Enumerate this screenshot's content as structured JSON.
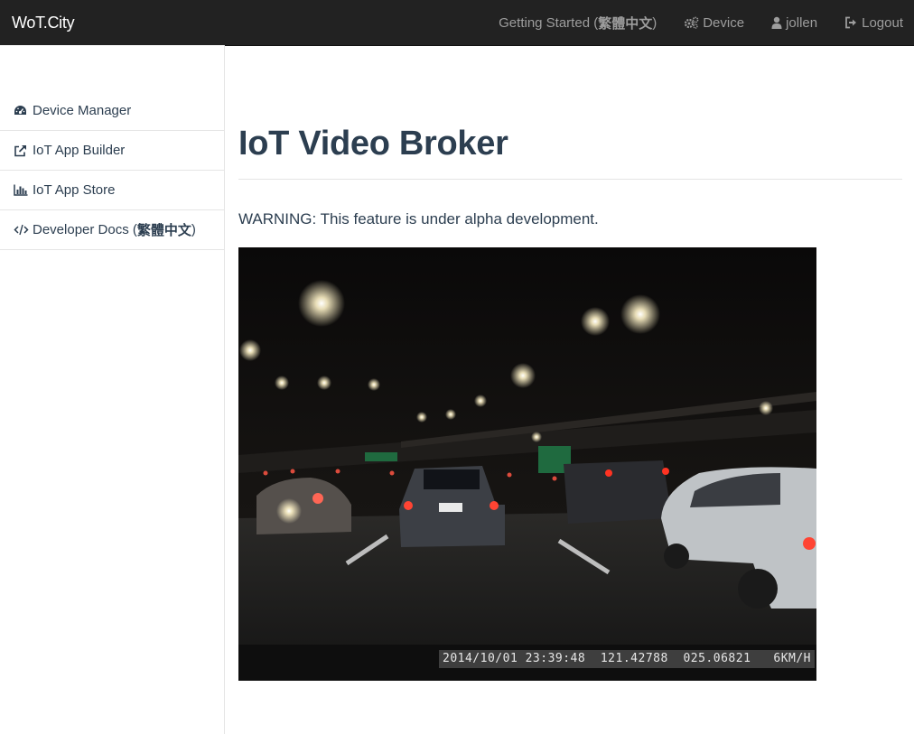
{
  "navbar": {
    "brand": "WoT.City",
    "getting_started_prefix": "Getting Started (",
    "getting_started_lang": "繁體中文",
    "getting_started_suffix": ")",
    "device_label": "Device",
    "user_label": "jollen",
    "logout_label": "Logout"
  },
  "sidebar": {
    "items": [
      {
        "label": "Device Manager",
        "icon": "dashboard-icon"
      },
      {
        "label": "IoT App Builder",
        "icon": "external-link-icon"
      },
      {
        "label": "IoT App Store",
        "icon": "bar-chart-icon"
      },
      {
        "label": "Developer Docs (",
        "label_bold": "繁體中文",
        "label_suffix": ")",
        "icon": "code-icon"
      }
    ]
  },
  "main": {
    "title": "IoT Video Broker",
    "warning": "WARNING: This feature is under alpha development.",
    "video_overlay": "2014/10/01 23:39:48  121.42788  025.06821   6KM/H"
  },
  "colors": {
    "navbar_bg": "#222222",
    "navbar_text": "#9d9d9d",
    "brand_text": "#ffffff",
    "heading": "#2c3e50",
    "divider": "#e5e5e5"
  }
}
